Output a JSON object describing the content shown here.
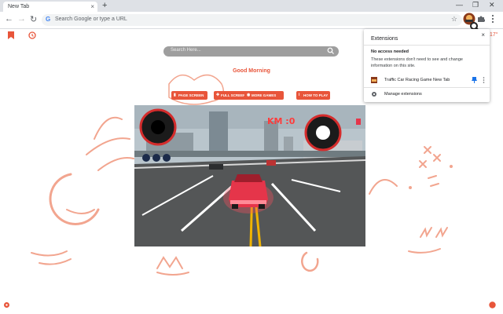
{
  "browser": {
    "tab_title": "New Tab",
    "tab_close": "×",
    "new_tab": "+",
    "window_minimize": "—",
    "window_restore": "❐",
    "window_close": "✕",
    "omnibox_placeholder": "Search Google or type a URL",
    "google_letter": "G",
    "bookmark_star": "☆"
  },
  "page": {
    "search_placeholder": "Search Here...",
    "greeting": "Good Morning",
    "buttons": [
      {
        "label": "PAGE SCREEN",
        "icon": "page-icon"
      },
      {
        "label": "FULL SCREEN",
        "icon": "expand-icon"
      },
      {
        "label": "MORE GAMES",
        "icon": "gamepad-icon"
      },
      {
        "label": "HOW TO PLAY",
        "icon": "info-icon"
      }
    ],
    "side_temp": "17°",
    "game": {
      "speed_label": "KM :0"
    },
    "accent_color": "#e8553a"
  },
  "extensions_popup": {
    "title": "Extensions",
    "close": "×",
    "section_title": "No access needed",
    "section_desc": "These extensions don't need to see and change information on this site.",
    "extension_name": "Traffic Car Racing Game New Tab",
    "manage_label": "Manage extensions"
  }
}
